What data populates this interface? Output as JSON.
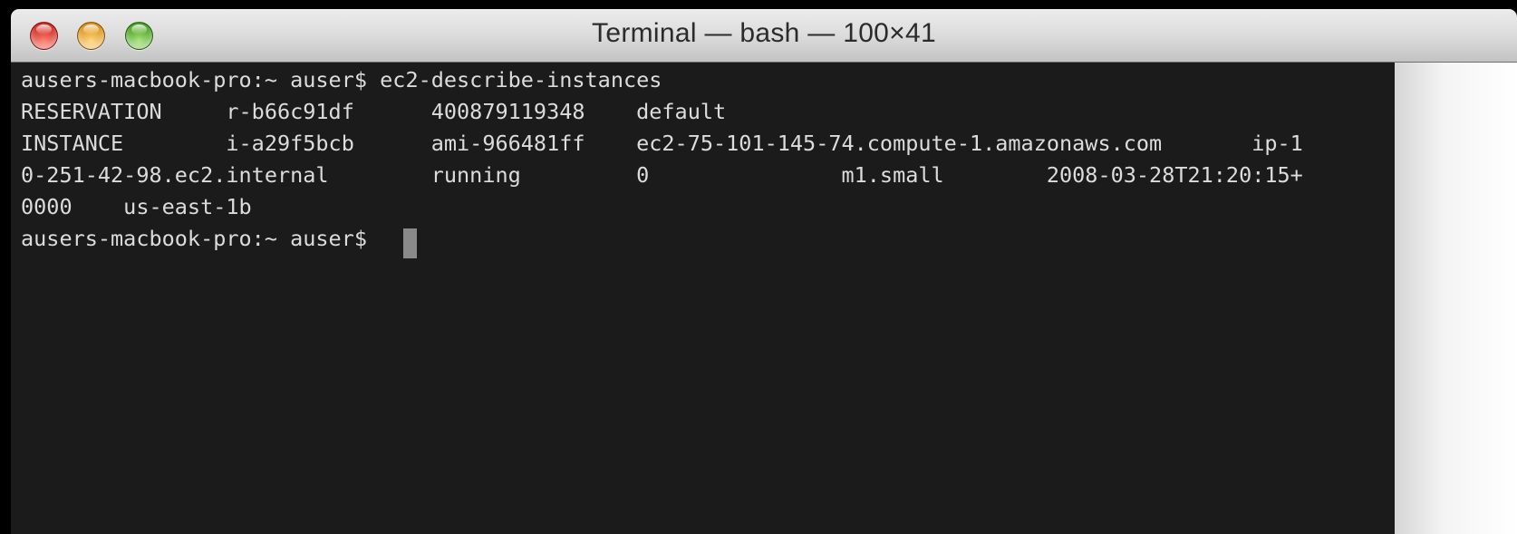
{
  "window": {
    "title": "Terminal — bash — 100×41"
  },
  "terminal": {
    "lines": [
      "ausers-macbook-pro:~ auser$ ec2-describe-instances",
      "RESERVATION     r-b66c91df      400879119348    default",
      "INSTANCE        i-a29f5bcb      ami-966481ff    ec2-75-101-145-74.compute-1.amazonaws.com       ip-1",
      "0-251-42-98.ec2.internal        running         0               m1.small        2008-03-28T21:20:15+",
      "0000    us-east-1b",
      "ausers-macbook-pro:~ auser$ "
    ]
  },
  "colors": {
    "background": "#1b1b1b",
    "text": "#dcdcdc",
    "cursor": "#8a8a8a"
  }
}
